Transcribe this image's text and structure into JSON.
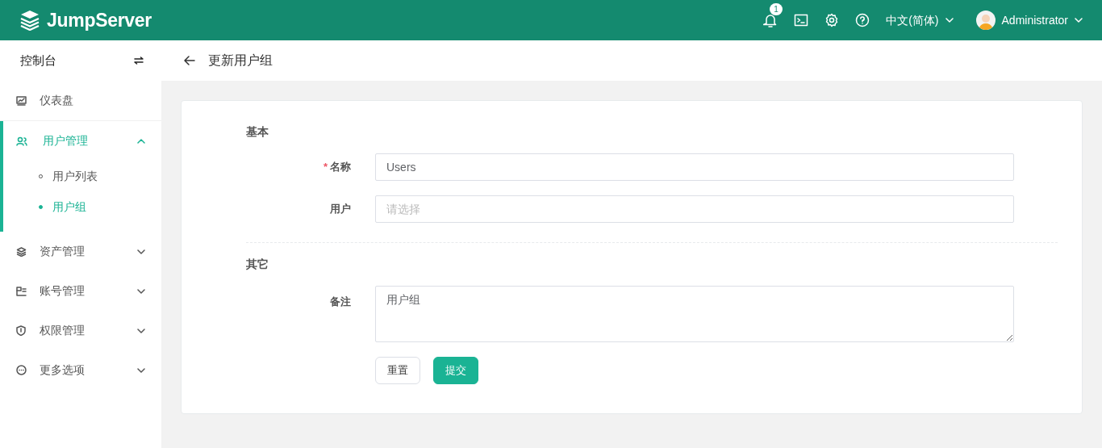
{
  "header": {
    "logo": "JumpServer",
    "notification_count": "1",
    "language": "中文(简体)",
    "user": "Administrator"
  },
  "sidebar": {
    "title": "控制台",
    "items": [
      {
        "label": "仪表盘",
        "selected": false,
        "expandable": false
      },
      {
        "label": "用户管理",
        "selected": true,
        "expandable": true,
        "expanded": true,
        "children": [
          {
            "label": "用户列表",
            "selected": false
          },
          {
            "label": "用户组",
            "selected": true
          }
        ]
      },
      {
        "label": "资产管理",
        "selected": false,
        "expandable": true,
        "expanded": false
      },
      {
        "label": "账号管理",
        "selected": false,
        "expandable": true,
        "expanded": false
      },
      {
        "label": "权限管理",
        "selected": false,
        "expandable": true,
        "expanded": false
      },
      {
        "label": "更多选项",
        "selected": false,
        "expandable": true,
        "expanded": false
      }
    ]
  },
  "page": {
    "title": "更新用户组"
  },
  "form": {
    "sections": [
      {
        "title": "基本",
        "fields": [
          {
            "kind": "text",
            "label": "名称",
            "required_mark": "*",
            "value": "Users"
          },
          {
            "kind": "select",
            "label": "用户",
            "placeholder": "请选择"
          }
        ]
      },
      {
        "title": "其它",
        "fields": [
          {
            "kind": "textarea",
            "label": "备注",
            "value": "用户组"
          }
        ]
      }
    ],
    "buttons": [
      {
        "kind": "reset",
        "label": "重置"
      },
      {
        "kind": "submit",
        "label": "提交"
      }
    ]
  }
}
